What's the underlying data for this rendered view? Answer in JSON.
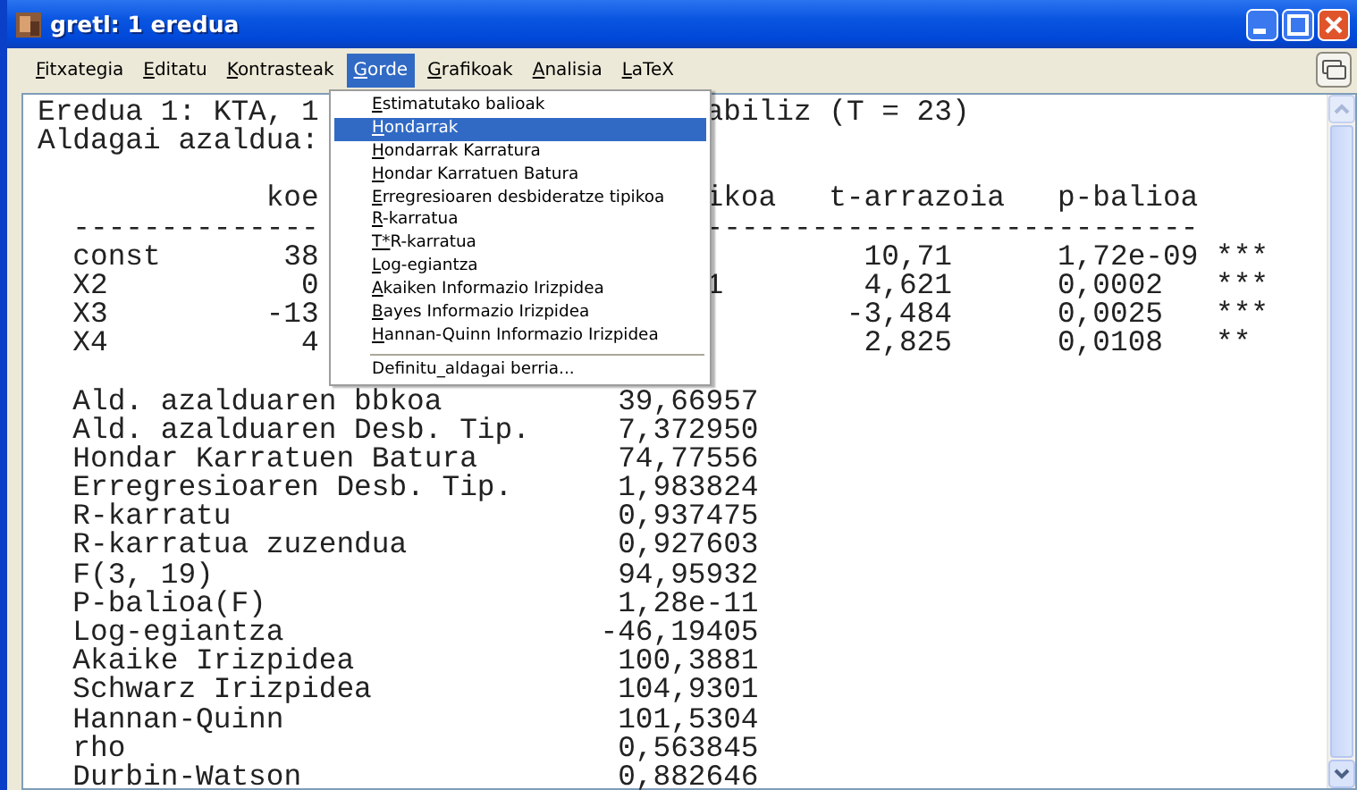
{
  "window": {
    "title": "gretl: 1 eredua"
  },
  "menubar": [
    {
      "label": "Fitxategia",
      "selected": false
    },
    {
      "label": "Editatu",
      "selected": false
    },
    {
      "label": "Kontrasteak",
      "selected": false
    },
    {
      "label": "Gorde",
      "selected": true
    },
    {
      "label": "Grafikoak",
      "selected": false
    },
    {
      "label": "Analisia",
      "selected": false
    },
    {
      "label": "LaTeX",
      "selected": false
    }
  ],
  "output": {
    "lines": [
      {
        "kind": "text",
        "left": "Eredua 1: KTA, 1",
        "right": "abiliz (T = 23)"
      },
      {
        "kind": "text",
        "left": "Aldagai azaldua:"
      },
      {
        "kind": "blank"
      },
      {
        "kind": "header",
        "coef": "koe",
        "se": "ikoa",
        "t": "t-arrazoia",
        "p": "p-balioa"
      },
      {
        "kind": "rule",
        "left": "--------------",
        "right": "----------------------------"
      },
      {
        "kind": "coef",
        "name": "const",
        "coef": "38",
        "t": "10,71",
        "p": "1,72e-09",
        "stars": "***"
      },
      {
        "kind": "coef",
        "name": "X2",
        "coef": "0",
        "se": "1",
        "t": "4,621",
        "p": "0,0002",
        "stars": "***"
      },
      {
        "kind": "coef",
        "name": "X3",
        "coef": "-13",
        "t": "-3,484",
        "p": "0,0025",
        "stars": "***"
      },
      {
        "kind": "coef",
        "name": "X4",
        "coef": "4",
        "t": "2,825",
        "p": "0,0108",
        "stars": "**"
      },
      {
        "kind": "blank"
      },
      {
        "kind": "stat",
        "label": "Ald. azalduaren bbkoa",
        "value": "39,66957"
      },
      {
        "kind": "stat",
        "label": "Ald. azalduaren Desb. Tip.",
        "value": "7,372950"
      },
      {
        "kind": "stat",
        "label": "Hondar Karratuen Batura",
        "value": "74,77556"
      },
      {
        "kind": "stat",
        "label": "Erregresioaren Desb. Tip.",
        "value": "1,983824"
      },
      {
        "kind": "stat",
        "label": "R-karratu",
        "value": "0,937475"
      },
      {
        "kind": "stat",
        "label": "R-karratua zuzendua",
        "value": "0,927603"
      },
      {
        "kind": "stat",
        "label": "F(3, 19)",
        "value": "94,95932"
      },
      {
        "kind": "stat",
        "label": "P-balioa(F)",
        "value": "1,28e-11"
      },
      {
        "kind": "stat",
        "label": "Log-egiantza",
        "value": "-46,19405"
      },
      {
        "kind": "stat",
        "label": "Akaike Irizpidea",
        "value": "100,3881"
      },
      {
        "kind": "stat",
        "label": "Schwarz Irizpidea",
        "value": "104,9301"
      },
      {
        "kind": "stat",
        "label": "Hannan-Quinn",
        "value": "101,5304"
      },
      {
        "kind": "stat",
        "label": "rho",
        "value": "0,563845"
      },
      {
        "kind": "stat",
        "label": "Durbin-Watson",
        "value": "0,882646"
      }
    ]
  },
  "menu": {
    "items": [
      {
        "kind": "item",
        "label": "Estimatutako balioak",
        "selected": false
      },
      {
        "kind": "item",
        "label": "Hondarrak",
        "selected": true
      },
      {
        "kind": "item",
        "label": "Hondarrak Karratura",
        "selected": false
      },
      {
        "kind": "item",
        "label": "Hondar Karratuen Batura",
        "selected": false
      },
      {
        "kind": "item",
        "label": "Erregresioaren desbideratze tipikoa",
        "selected": false
      },
      {
        "kind": "item",
        "label": "R-karratua",
        "selected": false
      },
      {
        "kind": "item",
        "label": "T*R-karratua",
        "selected": false
      },
      {
        "kind": "item",
        "label": "Log-egiantza",
        "selected": false
      },
      {
        "kind": "item",
        "label": "Akaiken Informazio Irizpidea",
        "selected": false
      },
      {
        "kind": "item",
        "label": "Bayes Informazio Irizpidea",
        "selected": false
      },
      {
        "kind": "item",
        "label": "Hannan-Quinn Informazio Irizpidea",
        "selected": false
      },
      {
        "kind": "separator"
      },
      {
        "kind": "command",
        "label": "Definitu_aldagai berria...",
        "selected": false
      }
    ]
  }
}
